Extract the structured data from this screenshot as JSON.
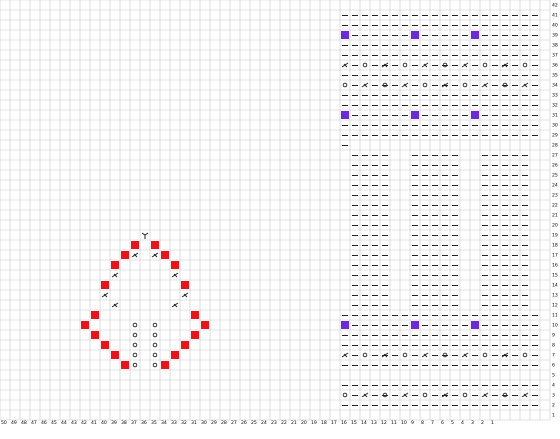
{
  "window": {
    "title": ""
  },
  "grid": {
    "columns": 55,
    "rows": 42,
    "col_labels": [
      "50",
      "49",
      "48",
      "47",
      "46",
      "45",
      "44",
      "43",
      "42",
      "41",
      "40",
      "39",
      "38",
      "37",
      "36",
      "35",
      "34",
      "33",
      "32",
      "31",
      "30",
      "29",
      "28",
      "27",
      "26",
      "25",
      "24",
      "23",
      "22",
      "21",
      "20",
      "19",
      "18",
      "17",
      "16",
      "15",
      "14",
      "13",
      "12",
      "11",
      "10",
      "9",
      "8",
      "7",
      "6",
      "5",
      "4",
      "3",
      "2",
      "1"
    ],
    "row_labels": [
      "42",
      "41",
      "40",
      "39",
      "38",
      "37",
      "36",
      "35",
      "34",
      "33",
      "32",
      "31",
      "30",
      "29",
      "28",
      "27",
      "26",
      "25",
      "24",
      "23",
      "22",
      "21",
      "20",
      "19",
      "18",
      "17",
      "16",
      "15",
      "14",
      "13",
      "12",
      "11",
      "10",
      "9",
      "8",
      "7",
      "6",
      "5",
      "4",
      "3",
      "2",
      "1"
    ],
    "colors": {
      "background": "#ffffff",
      "grid_line": "#c8c8c8",
      "major_line": "#000000",
      "red_square": "#e8141c",
      "purple_square": "#6a2bd6",
      "symbol": "#222222"
    }
  },
  "chart_data": {
    "type": "heatmap",
    "title": "",
    "xlabel": "",
    "ylabel": "",
    "legend": [],
    "red_squares": [
      [
        13,
        24
      ],
      [
        15,
        24
      ],
      [
        12,
        25
      ],
      [
        16,
        25
      ],
      [
        11,
        26
      ],
      [
        17,
        26
      ],
      [
        10,
        28
      ],
      [
        18,
        28
      ],
      [
        9,
        31
      ],
      [
        19,
        31
      ],
      [
        8,
        32
      ],
      [
        20,
        32
      ],
      [
        9,
        33
      ],
      [
        19,
        33
      ],
      [
        10,
        34
      ],
      [
        18,
        34
      ],
      [
        11,
        35
      ],
      [
        17,
        35
      ],
      [
        12,
        36
      ],
      [
        16,
        36
      ]
    ],
    "purple_squares": [
      [
        34,
        3
      ],
      [
        41,
        3
      ],
      [
        47,
        3
      ],
      [
        34,
        11
      ],
      [
        41,
        11
      ],
      [
        47,
        11
      ],
      [
        34,
        32
      ],
      [
        41,
        32
      ],
      [
        47,
        32
      ]
    ],
    "symbols": [
      {
        "sym": "Y",
        "cells": [
          [
            14,
            23
          ]
        ]
      },
      {
        "sym": "x",
        "cells": [
          [
            13,
            25
          ],
          [
            15,
            25
          ],
          [
            11,
            27
          ],
          [
            17,
            27
          ],
          [
            10,
            29
          ],
          [
            18,
            29
          ],
          [
            11,
            30
          ],
          [
            17,
            30
          ]
        ]
      },
      {
        "sym": "o",
        "cells": [
          [
            13,
            32
          ],
          [
            15,
            32
          ],
          [
            13,
            33
          ],
          [
            15,
            33
          ],
          [
            13,
            34
          ],
          [
            15,
            34
          ],
          [
            13,
            35
          ],
          [
            15,
            35
          ],
          [
            13,
            36
          ],
          [
            15,
            36
          ]
        ]
      }
    ],
    "dash_rows": [
      {
        "row": 1,
        "cols": [
          34,
          35,
          36,
          37,
          38,
          39,
          40,
          41,
          42,
          43,
          44,
          45,
          46,
          47,
          48,
          49,
          50,
          51,
          52,
          53
        ]
      },
      {
        "row": 2,
        "cols": [
          34,
          35,
          36,
          37,
          38,
          39,
          40,
          41,
          42,
          43,
          44,
          45,
          46,
          47,
          48,
          49,
          50,
          51,
          52,
          53
        ]
      },
      {
        "row": 3,
        "cols": [
          35,
          36,
          37,
          38,
          39,
          40,
          42,
          43,
          44,
          45,
          46,
          48,
          49,
          50,
          51,
          52,
          53
        ]
      },
      {
        "row": 4,
        "cols": [
          34,
          35,
          36,
          37,
          38,
          39,
          40,
          41,
          42,
          43,
          44,
          45,
          46,
          47,
          48,
          49,
          50,
          51,
          52,
          53
        ]
      },
      {
        "row": 5,
        "cols": [
          34,
          35,
          36,
          37,
          38,
          39,
          40,
          41,
          42,
          43,
          44,
          45,
          46,
          47,
          48,
          49,
          50,
          51,
          52,
          53
        ]
      },
      {
        "row": 6,
        "cols": [
          35,
          37,
          38,
          39,
          41,
          43,
          44,
          45,
          47,
          49,
          50,
          51,
          53
        ]
      },
      {
        "row": 7,
        "cols": [
          34,
          35,
          36,
          37,
          38,
          39,
          40,
          41,
          42,
          43,
          44,
          45,
          46,
          47,
          48,
          49,
          50,
          51,
          52,
          53
        ]
      },
      {
        "row": 8,
        "cols": [
          35,
          37,
          38,
          39,
          41,
          43,
          44,
          45,
          47,
          49,
          50,
          51,
          53
        ]
      },
      {
        "row": 9,
        "cols": [
          34,
          35,
          36,
          37,
          38,
          39,
          40,
          41,
          42,
          43,
          44,
          45,
          46,
          47,
          48,
          49,
          50,
          51,
          52,
          53
        ]
      },
      {
        "row": 10,
        "cols": [
          34,
          35,
          36,
          37,
          38,
          39,
          40,
          41,
          42,
          43,
          44,
          45,
          46,
          47,
          48,
          49,
          50,
          51,
          52,
          53
        ]
      },
      {
        "row": 11,
        "cols": [
          35,
          36,
          37,
          38,
          39,
          40,
          42,
          43,
          44,
          45,
          46,
          48,
          49,
          50,
          51,
          52,
          53
        ]
      },
      {
        "row": 12,
        "cols": [
          34,
          35,
          36,
          37,
          38,
          39,
          40,
          41,
          42,
          43,
          44,
          45,
          46,
          47,
          48,
          49,
          50,
          51,
          52,
          53
        ]
      },
      {
        "row": 13,
        "cols": [
          34,
          35,
          36,
          37,
          38,
          39,
          40,
          41,
          42,
          43,
          44,
          45,
          46,
          47,
          48,
          49,
          50,
          51,
          52,
          53
        ]
      },
      {
        "row": 14,
        "cols": [
          34
        ]
      },
      {
        "row": 15,
        "cols": [
          35,
          36,
          37,
          38,
          41,
          42,
          43,
          44,
          45,
          48,
          49,
          50,
          51,
          52
        ]
      },
      {
        "row": 16,
        "cols": [
          35,
          36,
          37,
          38,
          41,
          42,
          43,
          44,
          45,
          48,
          49,
          50,
          51,
          52
        ]
      },
      {
        "row": 17,
        "cols": [
          35,
          36,
          37,
          38,
          41,
          42,
          43,
          44,
          45,
          48,
          49,
          50,
          51,
          52
        ]
      },
      {
        "row": 18,
        "cols": [
          35,
          36,
          37,
          38,
          41,
          42,
          43,
          44,
          45,
          48,
          49,
          50,
          51,
          52
        ]
      },
      {
        "row": 19,
        "cols": [
          35,
          36,
          37,
          38,
          41,
          42,
          43,
          44,
          45,
          48,
          49,
          50,
          51,
          52
        ]
      },
      {
        "row": 20,
        "cols": [
          35,
          36,
          37,
          38,
          41,
          42,
          43,
          44,
          45,
          48,
          49,
          50,
          51,
          52
        ]
      },
      {
        "row": 21,
        "cols": [
          35,
          36,
          37,
          38,
          41,
          42,
          43,
          44,
          45,
          48,
          49,
          50,
          51,
          52
        ]
      },
      {
        "row": 22,
        "cols": [
          35,
          36,
          37,
          38,
          41,
          42,
          43,
          44,
          45,
          48,
          49,
          50,
          51,
          52
        ]
      },
      {
        "row": 23,
        "cols": [
          35,
          36,
          37,
          38,
          41,
          42,
          43,
          44,
          45,
          48,
          49,
          50,
          51,
          52
        ]
      },
      {
        "row": 24,
        "cols": [
          35,
          36,
          37,
          38,
          41,
          42,
          43,
          44,
          45,
          48,
          49,
          50,
          51,
          52
        ]
      },
      {
        "row": 25,
        "cols": [
          35,
          36,
          37,
          38,
          41,
          42,
          43,
          44,
          45,
          48,
          49,
          50,
          51,
          52
        ]
      },
      {
        "row": 26,
        "cols": [
          35,
          36,
          37,
          38,
          41,
          42,
          43,
          44,
          45,
          48,
          49,
          50,
          51,
          52
        ]
      },
      {
        "row": 27,
        "cols": [
          35,
          36,
          37,
          38,
          41,
          42,
          43,
          44,
          45,
          48,
          49,
          50,
          51,
          52
        ]
      },
      {
        "row": 28,
        "cols": [
          35,
          36,
          37,
          38,
          41,
          42,
          43,
          44,
          45,
          48,
          49,
          50,
          51,
          52
        ]
      },
      {
        "row": 29,
        "cols": [
          35,
          36,
          37,
          38,
          41,
          42,
          43,
          44,
          45,
          48,
          49,
          50,
          51,
          52
        ]
      },
      {
        "row": 30,
        "cols": [
          35,
          36,
          37,
          38,
          41,
          42,
          43,
          44,
          45,
          48,
          49,
          50,
          51,
          52
        ]
      },
      {
        "row": 31,
        "cols": [
          34,
          35,
          36,
          37,
          38,
          39,
          40,
          41,
          42,
          43,
          44,
          45,
          46,
          47,
          48,
          49,
          50,
          51,
          52,
          53
        ]
      },
      {
        "row": 32,
        "cols": [
          35,
          36,
          37,
          38,
          39,
          40,
          42,
          43,
          44,
          45,
          46,
          48,
          49,
          50,
          51,
          52,
          53
        ]
      },
      {
        "row": 33,
        "cols": [
          34,
          35,
          36,
          37,
          38,
          39,
          40,
          41,
          42,
          43,
          44,
          45,
          46,
          47,
          48,
          49,
          50,
          51,
          52,
          53
        ]
      },
      {
        "row": 34,
        "cols": [
          34,
          35,
          36,
          37,
          38,
          39,
          40,
          41,
          42,
          43,
          44,
          45,
          46,
          47,
          48,
          49,
          50,
          51,
          52,
          53
        ]
      },
      {
        "row": 35,
        "cols": [
          35,
          37,
          38,
          39,
          41,
          43,
          44,
          45,
          47,
          49,
          50,
          51,
          53
        ]
      },
      {
        "row": 36,
        "cols": [
          34,
          35,
          36,
          37,
          38,
          39,
          40,
          41,
          42,
          43,
          44,
          45,
          46,
          47,
          48,
          49,
          50,
          51,
          52,
          53
        ]
      },
      {
        "row": 38,
        "cols": [
          34,
          35,
          36,
          37,
          38,
          39,
          40,
          41,
          42,
          43,
          44,
          45,
          46,
          47,
          48,
          49,
          50,
          51,
          52,
          53
        ]
      },
      {
        "row": 39,
        "cols": [
          35,
          37,
          38,
          39,
          41,
          43,
          44,
          45,
          47,
          49,
          50,
          51,
          53
        ]
      },
      {
        "row": 40,
        "cols": [
          34,
          35,
          36,
          37,
          38,
          39,
          40,
          41,
          42,
          43,
          44,
          45,
          46,
          47,
          48,
          49,
          50,
          51,
          52,
          53
        ]
      }
    ],
    "pattern_symbol_rows": [
      {
        "row": 6,
        "sym": "x",
        "cols": [
          34,
          38,
          42,
          46,
          50
        ]
      },
      {
        "row": 6,
        "sym": "o",
        "cols": [
          36,
          40,
          44,
          48,
          52
        ]
      },
      {
        "row": 8,
        "sym": "o",
        "cols": [
          34,
          38,
          42,
          46,
          50
        ]
      },
      {
        "row": 8,
        "sym": "x",
        "cols": [
          36,
          40,
          44,
          48,
          52
        ]
      },
      {
        "row": 35,
        "sym": "x",
        "cols": [
          34,
          38,
          42,
          46,
          50
        ]
      },
      {
        "row": 35,
        "sym": "o",
        "cols": [
          36,
          40,
          44,
          48,
          52
        ]
      },
      {
        "row": 39,
        "sym": "o",
        "cols": [
          34,
          38,
          42,
          46,
          50
        ]
      },
      {
        "row": 39,
        "sym": "x",
        "cols": [
          36,
          40,
          44,
          48,
          52
        ]
      }
    ],
    "marker_rows": [
      14,
      31
    ],
    "marker_cols": [
      27,
      34
    ]
  }
}
